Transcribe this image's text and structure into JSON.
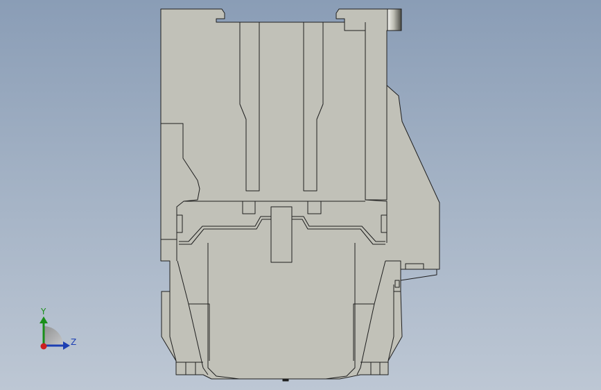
{
  "viewport": {
    "background_top": "#8a9db6",
    "background_bottom": "#bdc7d4"
  },
  "part": {
    "face_color": "#c1c1b8",
    "edge_color": "#1e1e1e"
  },
  "triad": {
    "y_label": "Y",
    "z_label": "Z",
    "y_color": "#1a8f1a",
    "z_color": "#1d3fb3",
    "x_color": "#cc1f1f"
  }
}
